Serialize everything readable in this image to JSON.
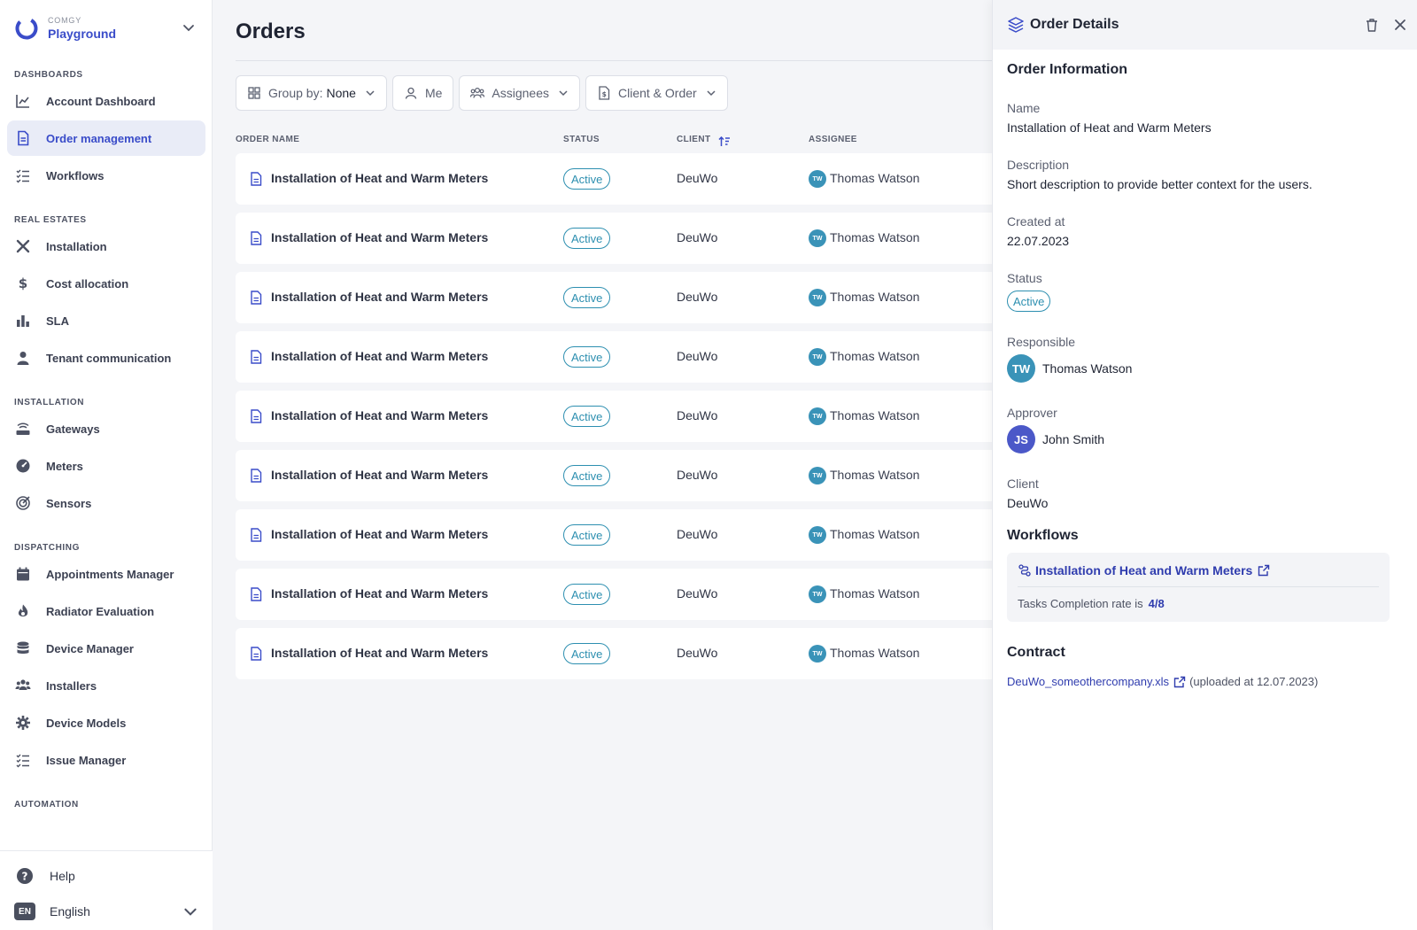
{
  "brand": {
    "company": "COMGY",
    "workspace": "Playground"
  },
  "colors": {
    "accent": "#3a4cc9",
    "status": "#2d8fb0",
    "approver_avatar": "#4b58c8",
    "responsible_avatar": "#3a93b8"
  },
  "sidebar": {
    "sections": [
      {
        "title": "DASHBOARDS",
        "items": [
          {
            "label": "Account Dashboard",
            "icon": "chart-line-icon"
          },
          {
            "label": "Order management",
            "icon": "document-icon",
            "active": true
          },
          {
            "label": "Workflows",
            "icon": "checklist-icon"
          }
        ]
      },
      {
        "title": "REAL ESTATES",
        "items": [
          {
            "label": "Installation",
            "icon": "tools-icon"
          },
          {
            "label": "Cost allocation",
            "icon": "dollar-icon"
          },
          {
            "label": "SLA",
            "icon": "bar-chart-icon"
          },
          {
            "label": "Tenant communication",
            "icon": "user-icon"
          }
        ]
      },
      {
        "title": "INSTALLATION",
        "items": [
          {
            "label": "Gateways",
            "icon": "router-icon"
          },
          {
            "label": "Meters",
            "icon": "meter-icon"
          },
          {
            "label": "Sensors",
            "icon": "sensor-icon"
          }
        ]
      },
      {
        "title": "DISPATCHING",
        "items": [
          {
            "label": "Appointments Manager",
            "icon": "calendar-icon"
          },
          {
            "label": "Radiator Evaluation",
            "icon": "flame-icon"
          },
          {
            "label": "Device Manager",
            "icon": "database-icon"
          },
          {
            "label": "Installers",
            "icon": "users-icon"
          },
          {
            "label": "Device Models",
            "icon": "gear-icon"
          },
          {
            "label": "Issue Manager",
            "icon": "checklist-icon"
          }
        ]
      },
      {
        "title": "AUTOMATION",
        "items": []
      }
    ],
    "bottom": {
      "help": "Help",
      "language_code": "EN",
      "language": "English"
    }
  },
  "main": {
    "title": "Orders",
    "filters": {
      "group_label": "Group by:",
      "group_value": "None",
      "me": "Me",
      "assignees": "Assignees",
      "client_order": "Client & Order"
    },
    "columns": {
      "name": "ORDER NAME",
      "status": "STATUS",
      "client": "CLIENT",
      "assignee": "ASSIGNEE"
    },
    "rows": [
      {
        "name": "Installation of Heat and Warm Meters",
        "status": "Active",
        "client": "DeuWo",
        "initials": "TW",
        "assignee": "Thomas Watson"
      },
      {
        "name": "Installation of Heat and Warm Meters",
        "status": "Active",
        "client": "DeuWo",
        "initials": "TW",
        "assignee": "Thomas Watson"
      },
      {
        "name": "Installation of Heat and Warm Meters",
        "status": "Active",
        "client": "DeuWo",
        "initials": "TW",
        "assignee": "Thomas Watson"
      },
      {
        "name": "Installation of Heat and Warm Meters",
        "status": "Active",
        "client": "DeuWo",
        "initials": "TW",
        "assignee": "Thomas Watson"
      },
      {
        "name": "Installation of Heat and Warm Meters",
        "status": "Active",
        "client": "DeuWo",
        "initials": "TW",
        "assignee": "Thomas Watson"
      },
      {
        "name": "Installation of Heat and Warm Meters",
        "status": "Active",
        "client": "DeuWo",
        "initials": "TW",
        "assignee": "Thomas Watson"
      },
      {
        "name": "Installation of Heat and Warm Meters",
        "status": "Active",
        "client": "DeuWo",
        "initials": "TW",
        "assignee": "Thomas Watson"
      },
      {
        "name": "Installation of Heat and Warm Meters",
        "status": "Active",
        "client": "DeuWo",
        "initials": "TW",
        "assignee": "Thomas Watson"
      },
      {
        "name": "Installation of Heat and Warm Meters",
        "status": "Active",
        "client": "DeuWo",
        "initials": "TW",
        "assignee": "Thomas Watson"
      }
    ]
  },
  "details": {
    "title": "Order Details",
    "section_title": "Order Information",
    "name_label": "Name",
    "name": "Installation of Heat and Warm Meters",
    "description_label": "Description",
    "description": "Short description to provide better context for the users.",
    "created_label": "Created at",
    "created": "22.07.2023",
    "status_label": "Status",
    "status": "Active",
    "responsible_label": "Responsible",
    "responsible_initials": "TW",
    "responsible": "Thomas Watson",
    "approver_label": "Approver",
    "approver_initials": "JS",
    "approver": "John Smith",
    "client_label": "Client",
    "client": "DeuWo",
    "workflows_title": "Workflows",
    "workflow_name": "Installation of Heat and Warm Meters",
    "completion_label": "Tasks Completion rate is",
    "completion_value": "4/8",
    "contract_title": "Contract",
    "contract_file": "DeuWo_someothercompany.xls",
    "contract_note": "(uploaded at 12.07.2023)"
  }
}
